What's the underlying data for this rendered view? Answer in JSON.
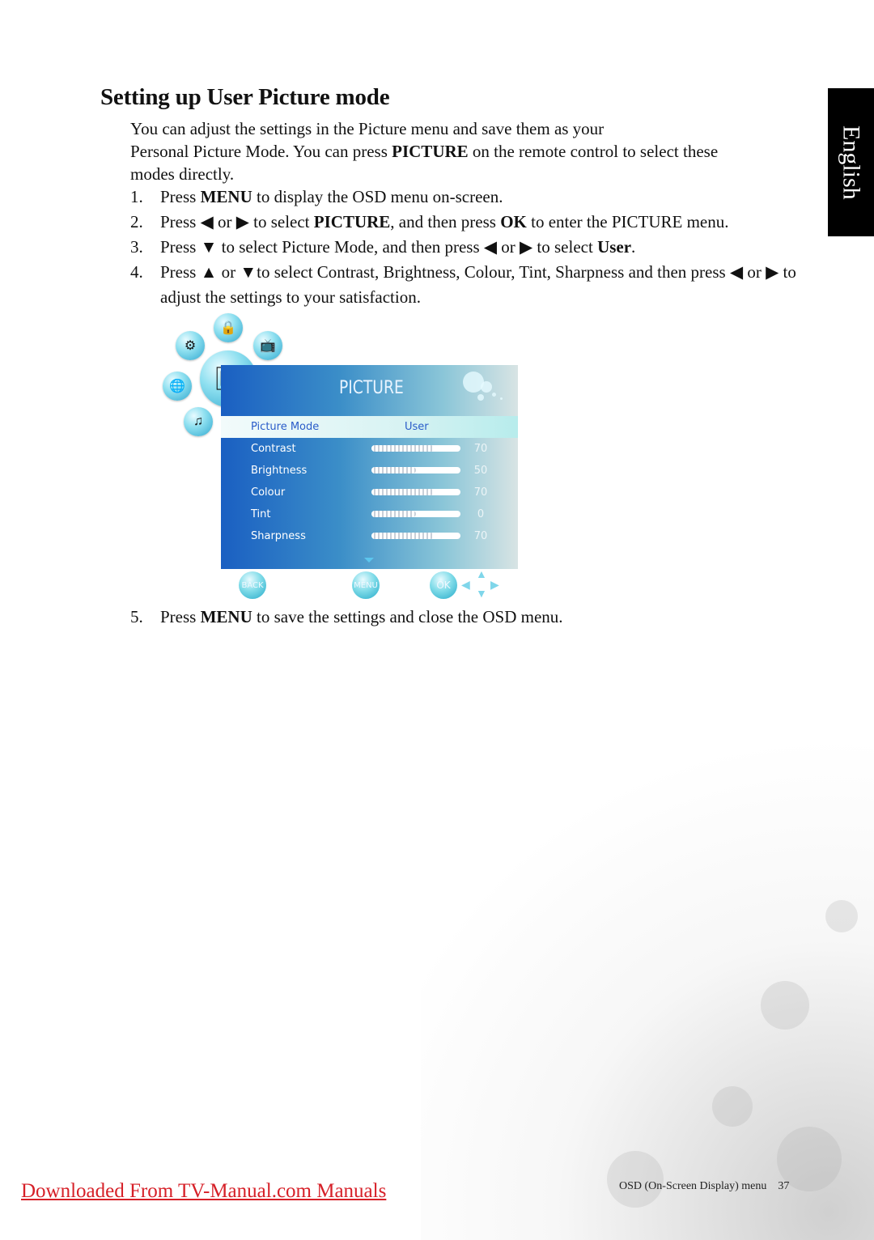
{
  "page": {
    "title": "Setting up User Picture mode",
    "intro": {
      "line1": "You can adjust the settings in the Picture menu and save them as your",
      "line2_pre": "Personal Picture Mode. You can press ",
      "line2_bold": "PICTURE",
      "line2_post": " on the remote control to select these",
      "line3": "modes directly."
    },
    "steps": [
      {
        "num": "1.",
        "parts": [
          {
            "t": "Press "
          },
          {
            "b": "MENU"
          },
          {
            "t": " to display the OSD menu on-screen."
          }
        ]
      },
      {
        "num": "2.",
        "parts": [
          {
            "t": "Press ◀ or ▶ to select "
          },
          {
            "b": "PICTURE"
          },
          {
            "t": ", and then press "
          },
          {
            "b": "OK"
          },
          {
            "t": " to enter the PICTURE menu."
          }
        ]
      },
      {
        "num": "3.",
        "parts": [
          {
            "t": "Press ▼ to select Picture Mode, and then press ◀ or ▶ to select "
          },
          {
            "b": "User"
          },
          {
            "t": "."
          }
        ]
      },
      {
        "num": "4.",
        "parts": [
          {
            "t": "Press ▲ or ▼to select Contrast, Brightness, Colour, Tint, Sharpness and then press ◀ or ▶ to adjust the settings to your satisfaction."
          }
        ]
      }
    ],
    "step5": {
      "num": "5.",
      "pre": "Press ",
      "bold": "MENU",
      "post": " to save the settings and close the OSD menu."
    },
    "language_tab": "English"
  },
  "osd": {
    "header": "PICTURE",
    "icons": [
      "settings-gear-icon",
      "lock-icon",
      "tv-screen-icon",
      "picture-icon",
      "globe-clock-icon",
      "music-note-icon"
    ],
    "mode_row": {
      "label": "Picture Mode",
      "value": "User"
    },
    "rows": [
      {
        "label": "Contrast",
        "value": "70",
        "level": 70
      },
      {
        "label": "Brightness",
        "value": "50",
        "level": 50
      },
      {
        "label": "Colour",
        "value": "70",
        "level": 70
      },
      {
        "label": "Tint",
        "value": "0",
        "level": 50
      },
      {
        "label": "Sharpness",
        "value": "70",
        "level": 70
      }
    ],
    "footer": {
      "back": "BACK",
      "menu": "MENU",
      "ok": "OK"
    }
  },
  "footer": {
    "link": "Downloaded From TV-Manual.com Manuals",
    "section": "OSD (On-Screen Display) menu",
    "page_number": "37"
  }
}
